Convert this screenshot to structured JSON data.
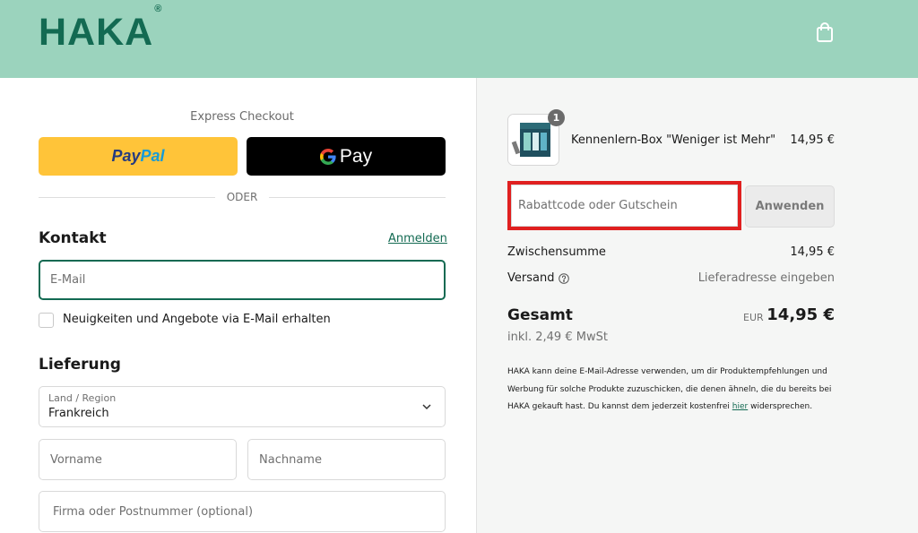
{
  "header": {
    "logo_text": "HAKA",
    "logo_mark": "®",
    "cart_icon": "shopping-bag-icon"
  },
  "checkout": {
    "express_title": "Express Checkout",
    "paypal_label_pay": "Pay",
    "paypal_label_pal": "Pal",
    "gpay_label": "Pay",
    "separator": "ODER"
  },
  "contact": {
    "title": "Kontakt",
    "login_link": "Anmelden",
    "email_placeholder": "E-Mail",
    "newsletter_label": "Neuigkeiten und Angebote via E-Mail erhalten"
  },
  "delivery": {
    "title": "Lieferung",
    "country_label": "Land / Region",
    "country_value": "Frankreich",
    "first_name_placeholder": "Vorname",
    "last_name_placeholder": "Nachname",
    "company_placeholder": "Firma oder Postnummer (optional)"
  },
  "summary": {
    "product": {
      "quantity": "1",
      "name": "Kennenlern-Box \"Weniger ist Mehr\"",
      "price": "14,95 €"
    },
    "discount_placeholder": "Rabattcode oder Gutschein",
    "apply_label": "Anwenden",
    "subtotal_label": "Zwischensumme",
    "subtotal_value": "14,95 €",
    "shipping_label": "Versand",
    "shipping_value": "Lieferadresse eingeben",
    "total_label": "Gesamt",
    "total_currency": "EUR",
    "total_value": "14,95 €",
    "tax_note": "inkl. 2,49 € MwSt",
    "legal_before": "HAKA kann deine E-Mail-Adresse verwenden, um dir Produktempfehlungen und Werbung für solche Produkte zuzuschicken, die denen ähneln, die du bereits bei HAKA gekauft hast. Du kannst dem jederzeit kostenfrei ",
    "legal_link": "hier",
    "legal_after": " widersprechen."
  },
  "colors": {
    "header_bg": "#9bd3bd",
    "brand": "#136a52",
    "paypal": "#ffc439",
    "highlight": "#e02020"
  }
}
